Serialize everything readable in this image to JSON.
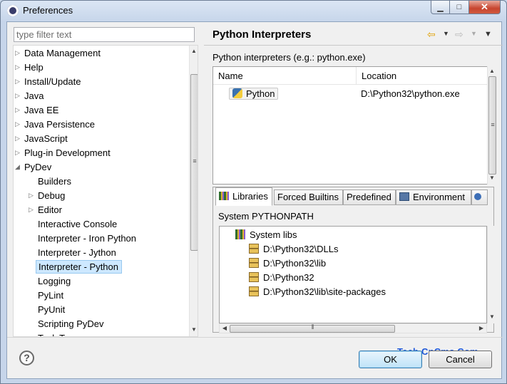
{
  "window": {
    "title": "Preferences",
    "buttons": {
      "minimize": "▁",
      "maximize": "□",
      "close": "✕"
    }
  },
  "filter": {
    "placeholder": "type filter text",
    "value": ""
  },
  "tree": {
    "items": [
      {
        "label": "Data Management",
        "level": 0,
        "twisty": "▷"
      },
      {
        "label": "Help",
        "level": 0,
        "twisty": "▷"
      },
      {
        "label": "Install/Update",
        "level": 0,
        "twisty": "▷"
      },
      {
        "label": "Java",
        "level": 0,
        "twisty": "▷"
      },
      {
        "label": "Java EE",
        "level": 0,
        "twisty": "▷"
      },
      {
        "label": "Java Persistence",
        "level": 0,
        "twisty": "▷"
      },
      {
        "label": "JavaScript",
        "level": 0,
        "twisty": "▷"
      },
      {
        "label": "Plug-in Development",
        "level": 0,
        "twisty": "▷"
      },
      {
        "label": "PyDev",
        "level": 0,
        "twisty": "◢"
      },
      {
        "label": "Builders",
        "level": 1,
        "twisty": ""
      },
      {
        "label": "Debug",
        "level": 1,
        "twisty": "▷"
      },
      {
        "label": "Editor",
        "level": 1,
        "twisty": "▷"
      },
      {
        "label": "Interactive Console",
        "level": 1,
        "twisty": ""
      },
      {
        "label": "Interpreter - Iron Python",
        "level": 1,
        "twisty": ""
      },
      {
        "label": "Interpreter - Jython",
        "level": 1,
        "twisty": ""
      },
      {
        "label": "Interpreter - Python",
        "level": 1,
        "twisty": "",
        "selected": true
      },
      {
        "label": "Logging",
        "level": 1,
        "twisty": ""
      },
      {
        "label": "PyLint",
        "level": 1,
        "twisty": ""
      },
      {
        "label": "PyUnit",
        "level": 1,
        "twisty": ""
      },
      {
        "label": "Scripting PyDev",
        "level": 1,
        "twisty": ""
      },
      {
        "label": "Task Tags",
        "level": 1,
        "twisty": ""
      }
    ]
  },
  "page": {
    "title": "Python Interpreters",
    "interpreters_label": "Python interpreters (e.g.: python.exe)",
    "columns": [
      "Name",
      "Location"
    ],
    "interpreters": [
      {
        "name": "Python",
        "location": "D:\\Python32\\python.exe"
      }
    ]
  },
  "tabs": [
    {
      "label": "Libraries",
      "icon": "libraries-icon",
      "active": true
    },
    {
      "label": "Forced Builtins",
      "icon": "",
      "active": false
    },
    {
      "label": "Predefined",
      "icon": "",
      "active": false
    },
    {
      "label": "Environment",
      "icon": "environment-icon",
      "active": false
    }
  ],
  "libraries": {
    "section_label": "System PYTHONPATH",
    "root": "System libs",
    "paths": [
      "D:\\Python32\\DLLs",
      "D:\\Python32\\lib",
      "D:\\Python32",
      "D:\\Python32\\lib\\site-packages"
    ]
  },
  "footer": {
    "help": "?",
    "ok_label": "OK",
    "cancel_label": "Cancel"
  },
  "watermark": "Tech.CnCms.Com"
}
